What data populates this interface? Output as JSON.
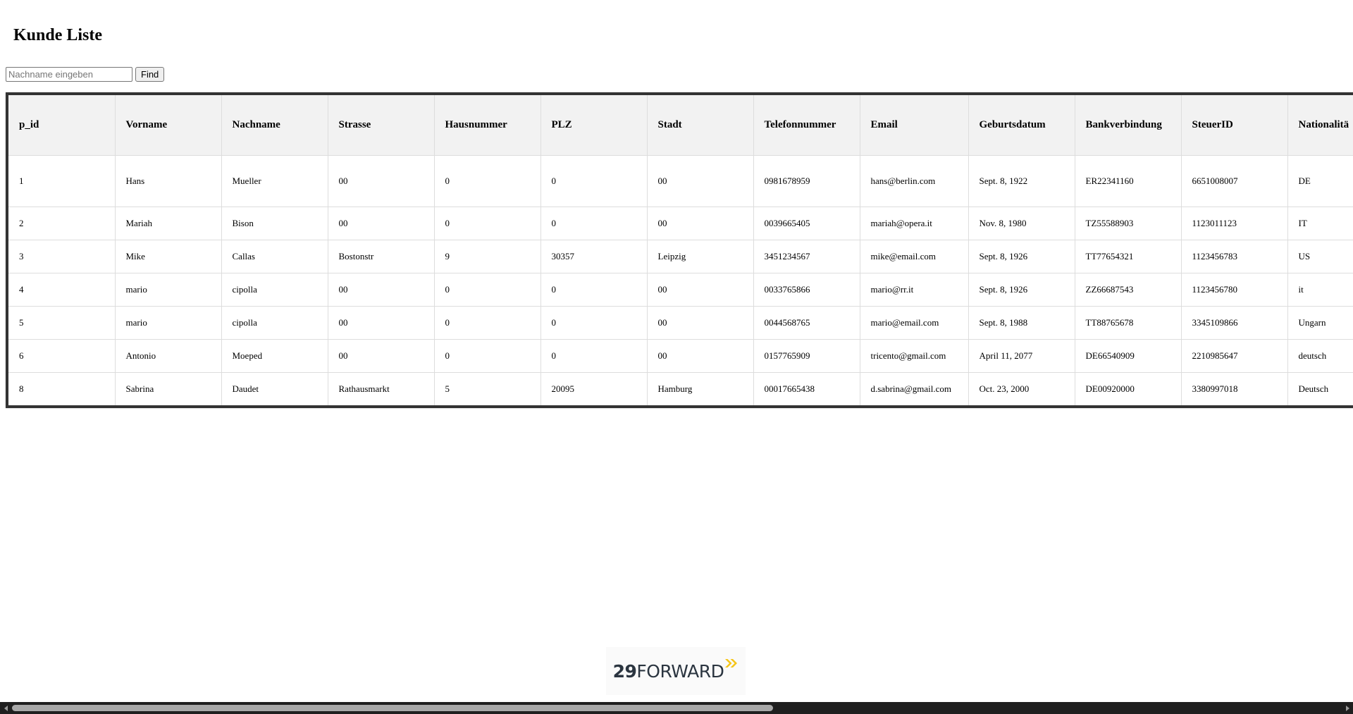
{
  "page": {
    "title": "Kunde Liste"
  },
  "search": {
    "placeholder": "Nachname eingeben",
    "value": "",
    "button_label": "Find"
  },
  "table": {
    "columns": [
      "p_id",
      "Vorname",
      "Nachname",
      "Strasse",
      "Hausnummer",
      "PLZ",
      "Stadt",
      "Telefonnummer",
      "Email",
      "Geburtsdatum",
      "Bankverbindung",
      "SteuerID",
      "Nationalitä"
    ],
    "rows": [
      [
        "1",
        "Hans",
        "Mueller",
        "00",
        "0",
        "0",
        "00",
        "0981678959",
        "hans@berlin.com",
        "Sept. 8, 1922",
        "ER22341160",
        "6651008007",
        "DE"
      ],
      [
        "2",
        "Mariah",
        "Bison",
        "00",
        "0",
        "0",
        "00",
        "0039665405",
        "mariah@opera.it",
        "Nov. 8, 1980",
        "TZ55588903",
        "1123011123",
        "IT"
      ],
      [
        "3",
        "Mike",
        "Callas",
        "Bostonstr",
        "9",
        "30357",
        "Leipzig",
        "3451234567",
        "mike@email.com",
        "Sept. 8, 1926",
        "TT77654321",
        "1123456783",
        "US"
      ],
      [
        "4",
        "mario",
        "cipolla",
        "00",
        "0",
        "0",
        "00",
        "0033765866",
        "mario@rr.it",
        "Sept. 8, 1926",
        "ZZ66687543",
        "1123456780",
        "it"
      ],
      [
        "5",
        "mario",
        "cipolla",
        "00",
        "0",
        "0",
        "00",
        "0044568765",
        "mario@email.com",
        "Sept. 8, 1988",
        "TT88765678",
        "3345109866",
        "Ungarn"
      ],
      [
        "6",
        "Antonio",
        "Moeped",
        "00",
        "0",
        "0",
        "00",
        "0157765909",
        "tricento@gmail.com",
        "April 11, 2077",
        "DE66540909",
        "2210985647",
        "deutsch"
      ],
      [
        "8",
        "Sabrina",
        "Daudet",
        "Rathausmarkt",
        "5",
        "20095",
        "Hamburg",
        "00017665438",
        "d.sabrina@gmail.com",
        "Oct. 23, 2000",
        "DE00920000",
        "3380997018",
        "Deutsch"
      ]
    ]
  },
  "footer": {
    "logo_number": "29",
    "logo_word": "FORWARD",
    "logo_accent_color": "#f5c518",
    "logo_text_color": "#2b3540"
  },
  "icons": {
    "scroll_left": "triangle-left-icon",
    "scroll_right": "triangle-right-icon",
    "logo_arrows": "double-chevron-right-icon"
  }
}
